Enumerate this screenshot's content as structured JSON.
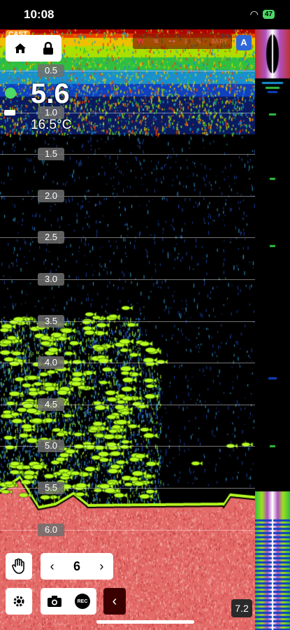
{
  "status": {
    "time": "10:08",
    "battery": "47"
  },
  "header": {
    "cast_label": "CAST",
    "auto_label": "A",
    "mode_labels": [
      "W",
      "BA PY"
    ]
  },
  "readout": {
    "depth": "5.6",
    "temperature": "16.5°C"
  },
  "depth_scale": [
    "0.5",
    "1.0",
    "1.5",
    "2.0",
    "2.5",
    "3.0",
    "3.5",
    "4.0",
    "4.5",
    "5.0",
    "5.5",
    "6.0"
  ],
  "controls": {
    "range_value": "6",
    "rec_label": "REC",
    "zoom_value": "7.2"
  },
  "colors": {
    "accent": "#2e67d8",
    "cast": "#f39a1e",
    "bottom": "#e46a68",
    "fish": "#b8ff20"
  }
}
